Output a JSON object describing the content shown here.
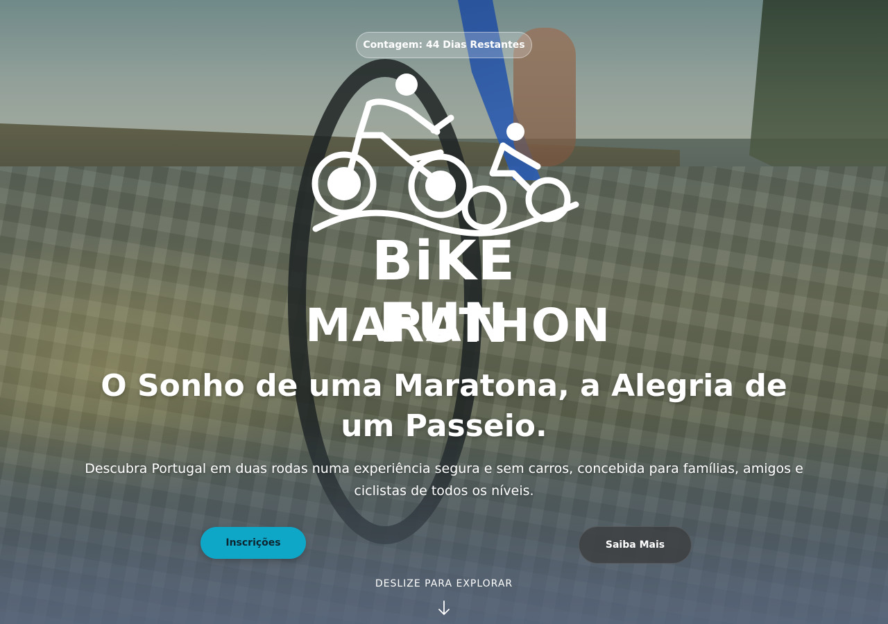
{
  "countdown": {
    "label": "Contagem: 44 Dias Restantes"
  },
  "logo": {
    "line1": "BiKE FUN",
    "line2": "MARATHON",
    "icon": "bike-family-logo-icon"
  },
  "hero": {
    "headline": "O Sonho de uma Maratona, a Alegria de um Passeio.",
    "subtext": "Descubra Portugal em duas rodas numa experiência segura e sem carros, concebida para famílias, amigos e ciclistas de todos os níveis."
  },
  "buttons": {
    "primary_label": "Inscrições",
    "secondary_label": "Saiba Mais"
  },
  "scroll": {
    "label": "DESLIZE PARA EXPLORAR",
    "icon": "arrow-down-icon"
  },
  "colors": {
    "accent": "#0fa7c8",
    "secondary_button": "#3c3e40",
    "text": "#ffffff"
  }
}
